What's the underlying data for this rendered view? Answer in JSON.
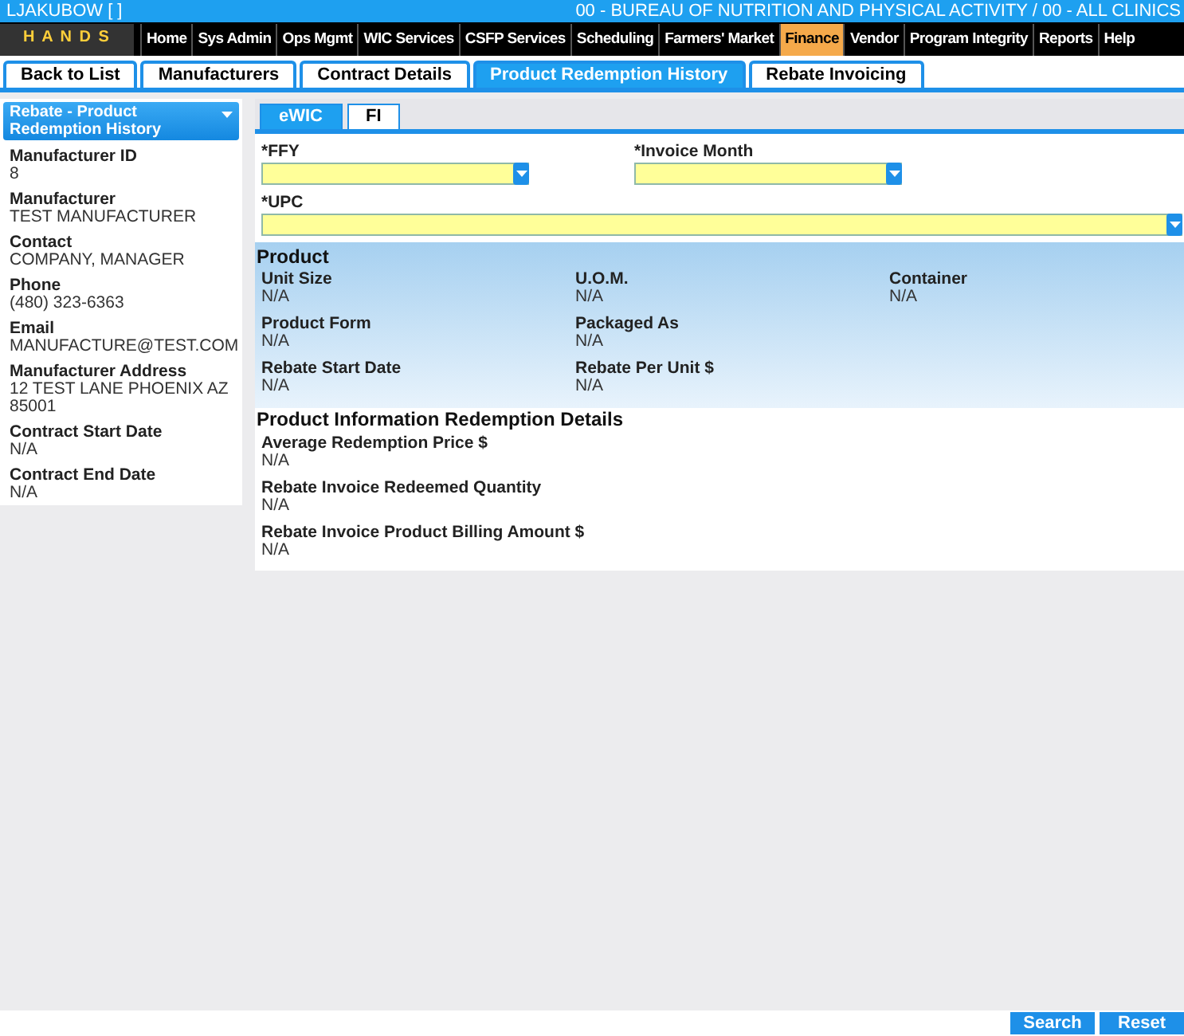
{
  "header": {
    "user": "LJAKUBOW [ ]",
    "agency": "00 - BUREAU OF NUTRITION AND PHYSICAL ACTIVITY / 00 - ALL CLINICS"
  },
  "logo": "H A N D S",
  "nav": [
    {
      "label": "Home",
      "selected": false
    },
    {
      "label": "Sys Admin",
      "selected": false
    },
    {
      "label": "Ops Mgmt",
      "selected": false
    },
    {
      "label": "WIC Services",
      "selected": false
    },
    {
      "label": "CSFP Services",
      "selected": false
    },
    {
      "label": "Scheduling",
      "selected": false
    },
    {
      "label": "Farmers' Market",
      "selected": false
    },
    {
      "label": "Finance",
      "selected": true
    },
    {
      "label": "Vendor",
      "selected": false
    },
    {
      "label": "Program Integrity",
      "selected": false
    },
    {
      "label": "Reports",
      "selected": false
    },
    {
      "label": "Help",
      "selected": false
    }
  ],
  "tabs": [
    {
      "label": "Back to List",
      "selected": false
    },
    {
      "label": "Manufacturers",
      "selected": false
    },
    {
      "label": "Contract Details",
      "selected": false
    },
    {
      "label": "Product Redemption History",
      "selected": true
    },
    {
      "label": "Rebate Invoicing",
      "selected": false
    }
  ],
  "sidebar": {
    "title": "Rebate - Product Redemption History",
    "fields": [
      {
        "label": "Manufacturer ID",
        "value": "8"
      },
      {
        "label": "Manufacturer",
        "value": "TEST MANUFACTURER"
      },
      {
        "label": "Contact",
        "value": "COMPANY, MANAGER"
      },
      {
        "label": "Phone",
        "value": "(480) 323-6363"
      },
      {
        "label": "Email",
        "value": "MANUFACTURE@TEST.COM"
      },
      {
        "label": "Manufacturer Address",
        "value": "12 TEST LANE PHOENIX AZ 85001"
      },
      {
        "label": "Contract Start Date",
        "value": "N/A"
      },
      {
        "label": "Contract End Date",
        "value": "N/A"
      }
    ]
  },
  "subtabs": [
    {
      "label": "eWIC",
      "selected": true
    },
    {
      "label": "FI",
      "selected": false
    }
  ],
  "filters": [
    {
      "label": "*FFY"
    },
    {
      "label": "*Invoice Month"
    }
  ],
  "upc": {
    "label": "*UPC"
  },
  "product": {
    "title": "Product",
    "fields": [
      {
        "label": "Unit Size",
        "value": "N/A"
      },
      {
        "label": "U.O.M.",
        "value": "N/A"
      },
      {
        "label": "Container",
        "value": "N/A"
      },
      {
        "label": "Product Form",
        "value": "N/A"
      },
      {
        "label": "Packaged As",
        "value": "N/A"
      },
      {
        "label": "Rebate Start Date",
        "value": "N/A"
      },
      {
        "label": "Rebate Per Unit $",
        "value": "N/A"
      }
    ]
  },
  "details": {
    "title": "Product Information Redemption Details",
    "fields": [
      {
        "label": "Average Redemption Price $",
        "value": "N/A"
      },
      {
        "label": "Rebate Invoice Redeemed Quantity",
        "value": "N/A"
      },
      {
        "label": "Rebate Invoice Product Billing Amount $",
        "value": "N/A"
      }
    ]
  },
  "buttons": [
    "Search",
    "Reset"
  ]
}
